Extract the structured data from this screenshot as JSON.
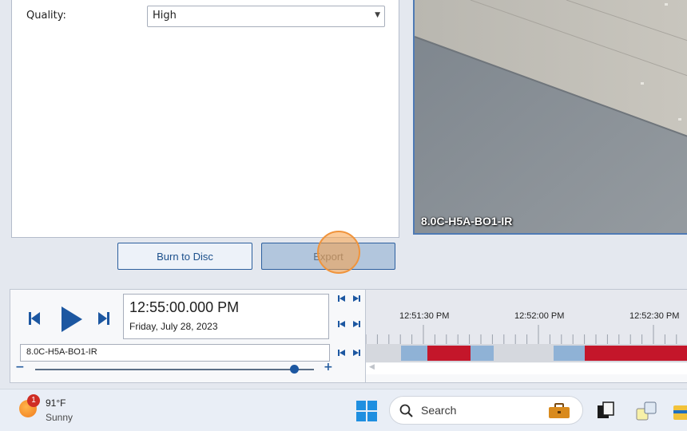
{
  "export_panel": {
    "quality_label": "Quality:",
    "quality_value": "High",
    "burn_button": "Burn to Disc",
    "export_button": "Export"
  },
  "video": {
    "camera_label": "8.0C-H5A-BO1-IR"
  },
  "playback": {
    "time": "12:55:00.000 PM",
    "date": "Friday, July 28, 2023",
    "camera_field": "8.0C-H5A-BO1-IR",
    "zoom_minus": "−",
    "zoom_plus": "+",
    "zoom_level": 0.93
  },
  "timeline": {
    "ticks": [
      "12:51:30 PM",
      "12:52:00 PM",
      "12:52:30 PM"
    ],
    "segments": [
      {
        "type": "motion",
        "color": "#8fb2d6"
      },
      {
        "type": "recording",
        "color": "#c4162a"
      },
      {
        "type": "motion",
        "color": "#8fb2d6"
      },
      {
        "type": "motion",
        "color": "#8fb2d6"
      },
      {
        "type": "recording",
        "color": "#c4162a"
      }
    ]
  },
  "taskbar": {
    "weather_badge": "1",
    "temperature": "91°F",
    "condition": "Sunny",
    "search_placeholder": "Search"
  },
  "colors": {
    "accent": "#1c57a1",
    "recording": "#c4162a",
    "motion": "#8fb2d6"
  }
}
